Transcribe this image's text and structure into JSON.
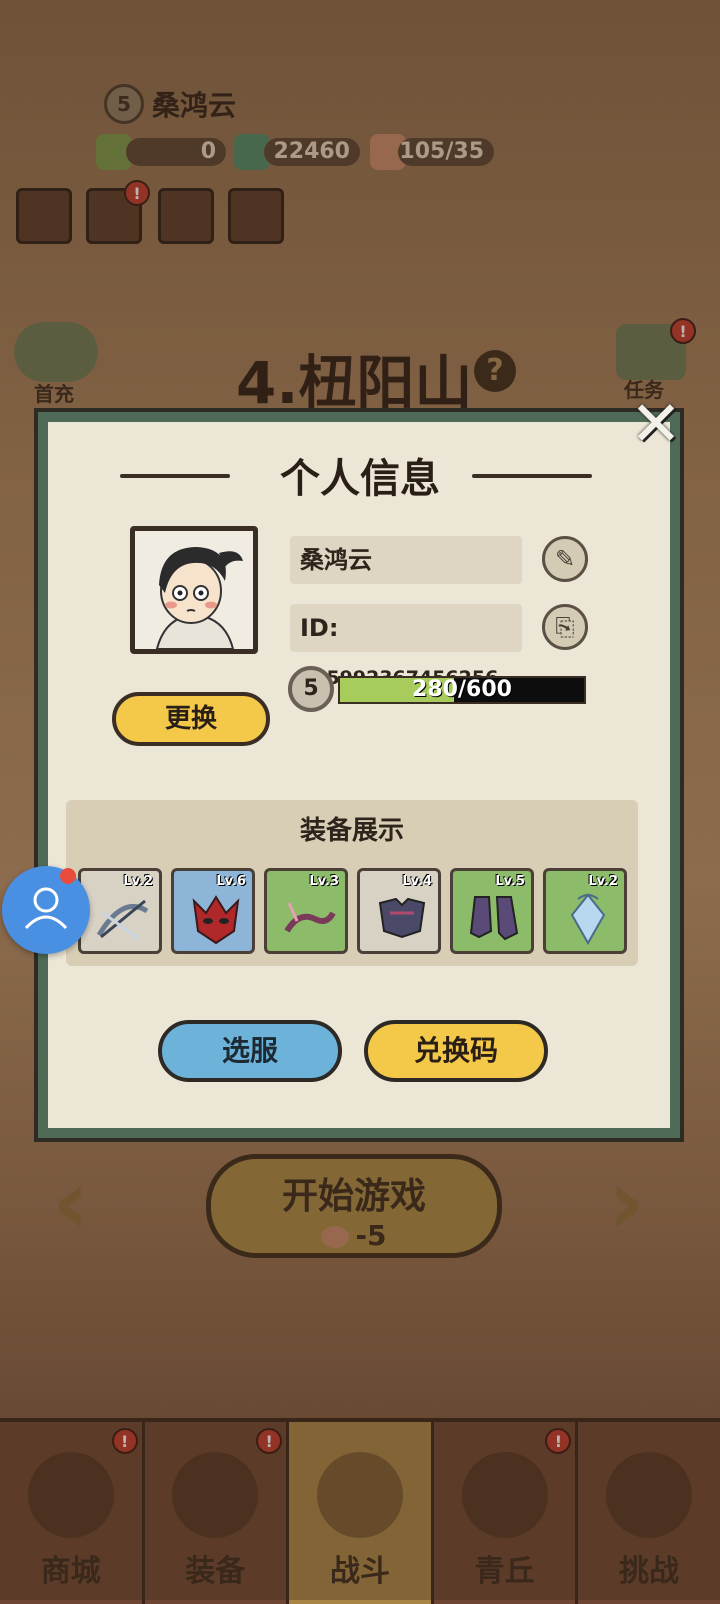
{
  "player": {
    "level": "5",
    "name": "桑鸿云",
    "id_label": "ID:",
    "id_value": "375992367456256",
    "xp_text": "280/600",
    "xp_fraction": 0.467
  },
  "resources": {
    "ticket_count": "0",
    "coin_count": "22460",
    "stamina": "105/35"
  },
  "stage": {
    "title": "4.杻阳山",
    "help_glyph": "?"
  },
  "side_buttons": {
    "first_recharge": "首充",
    "tasks": "任务"
  },
  "start_game": {
    "label": "开始游戏",
    "cost": "-5"
  },
  "bottom_nav": [
    {
      "label": "商城"
    },
    {
      "label": "装备"
    },
    {
      "label": "战斗"
    },
    {
      "label": "青丘"
    },
    {
      "label": "挑战"
    }
  ],
  "badge": "!",
  "modal": {
    "title": "个人信息",
    "change_button": "更换",
    "equip_title": "装备展示",
    "select_server": "选服",
    "redeem_code": "兑换码",
    "equipment": [
      {
        "level": "Lv.2",
        "rarity": "gray",
        "item": "crossbow"
      },
      {
        "level": "Lv.6",
        "rarity": "blue",
        "item": "mask"
      },
      {
        "level": "Lv.3",
        "rarity": "green",
        "item": "bracer"
      },
      {
        "level": "Lv.4",
        "rarity": "gray",
        "item": "armor"
      },
      {
        "level": "Lv.5",
        "rarity": "green",
        "item": "boots"
      },
      {
        "level": "Lv.2",
        "rarity": "green",
        "item": "pendant"
      }
    ]
  },
  "colors": {
    "yellow_button": "#f4c94a",
    "blue_button": "#6cb2d9",
    "xp_green": "#a7cc5c",
    "modal_frame": "#4f6b58"
  }
}
